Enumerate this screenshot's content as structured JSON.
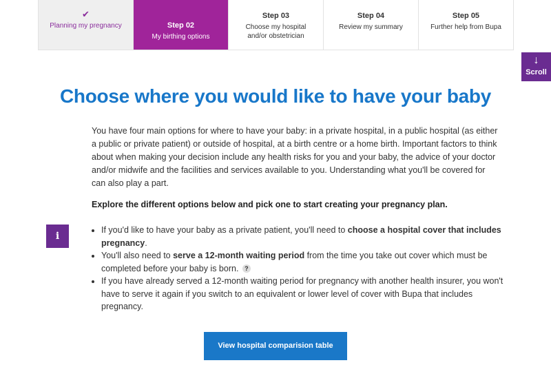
{
  "steps": [
    {
      "label": "",
      "desc": "Planning my pregnancy",
      "state": "done",
      "icon": "check-icon"
    },
    {
      "label": "Step 02",
      "desc": "My birthing options",
      "state": "active"
    },
    {
      "label": "Step 03",
      "desc": "Choose my hospital and/or obstetrician",
      "state": "pending"
    },
    {
      "label": "Step 04",
      "desc": "Review my summary",
      "state": "pending"
    },
    {
      "label": "Step 05",
      "desc": "Further help from Bupa",
      "state": "pending"
    }
  ],
  "check_glyph": "✔",
  "scroll": {
    "arrow": "↓",
    "label": "Scroll"
  },
  "title": "Choose where you would like to have your baby",
  "intro": "You have four main options for where to have your baby: in a private hospital, in a public hospital (as either a public or private patient) or outside of hospital, at a birth centre or a home birth. Important factors to think about when making your decision include any health risks for you and your baby, the advice of your doctor and/or midwife and the facilities and services available to you. Understanding what you'll be covered for can also play a part.",
  "explore": "Explore the different options below and pick one to start creating your pregnancy plan.",
  "info_glyph": "i",
  "bullets": [
    {
      "pre": "If you'd like to have your baby as a private patient, you'll need to ",
      "bold": "choose a hospital cover that includes pregnancy",
      "post": "."
    },
    {
      "pre": "You'll also need to ",
      "bold": "serve a 12-month waiting period",
      "post": " from the time you take out cover which must be completed before your baby is born.",
      "help": "?"
    },
    {
      "pre": "If you have already served a 12-month waiting period for pregnancy with another health insurer, you won't have to serve it again if you switch to an equivalent or lower level of cover with Bupa that includes pregnancy.",
      "bold": "",
      "post": ""
    }
  ],
  "cta": "View hospital comparision table",
  "colors": {
    "purple": "#a0249a",
    "dark_purple": "#6a2c91",
    "blue": "#1877c9",
    "button_blue": "#1a78c8"
  }
}
